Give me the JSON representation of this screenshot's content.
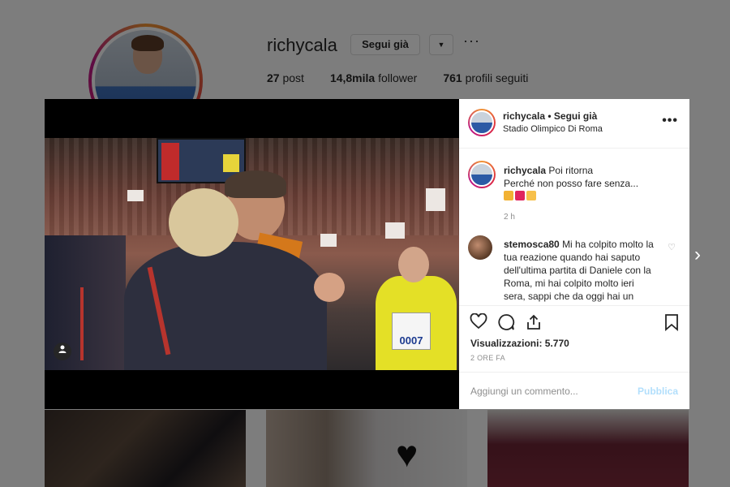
{
  "profile": {
    "username": "richycala",
    "follow_label": "Segui già",
    "dropdown_glyph": "▼",
    "more_glyph": "···",
    "stats": {
      "posts_count": "27",
      "posts_label": "post",
      "followers_count": "14,8mila",
      "followers_label": "follower",
      "following_count": "761",
      "following_label": "profili seguiti"
    }
  },
  "post": {
    "header": {
      "username": "richycala",
      "separator": " • ",
      "follow_status": "Segui già",
      "location": "Stadio Olimpico Di Roma",
      "menu_glyph": "•••"
    },
    "media": {
      "badge_number": "0007",
      "user_tag_icon": "user-icon"
    },
    "caption": {
      "username": "richycala",
      "line1": "Poi ritorna",
      "line2": "Perché non posso fare senza...",
      "emoji_colors": [
        "#f2b233",
        "#e0245e",
        "#f7c04a"
      ],
      "time": "2 h"
    },
    "comment": {
      "username": "stemosca80",
      "text": "Mi ha colpito molto la tua reazione quando hai saputo dell'ultima partita di Daniele con la Roma, mi hai colpito molto ieri sera, sappi che da oggi hai un tifoso in più, grande Riccardo!"
    },
    "actions": {
      "like_icon": "heart-icon",
      "comment_icon": "comment-icon",
      "share_icon": "share-icon",
      "save_icon": "bookmark-icon"
    },
    "views": "Visualizzazioni: 5.770",
    "posted_ago": "2 ORE FA",
    "add_comment_placeholder": "Aggiungi un commento...",
    "publish_label": "Pubblica"
  },
  "navigation": {
    "next_glyph": "›"
  }
}
